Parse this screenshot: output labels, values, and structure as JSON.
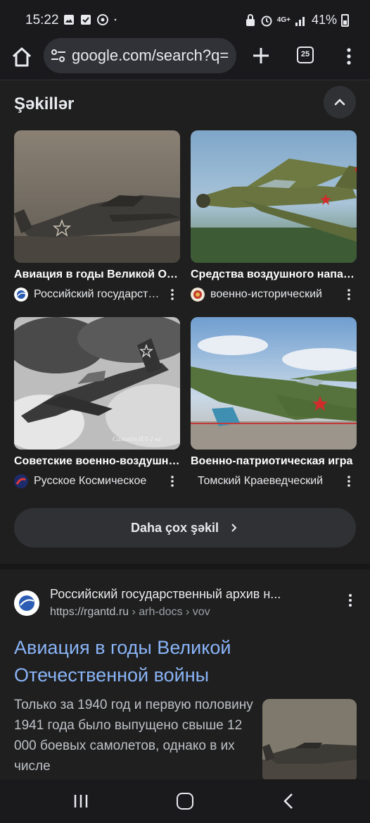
{
  "status_bar": {
    "time": "15:22",
    "network": "4G+",
    "battery": "41%"
  },
  "toolbar": {
    "url": "google.com/search?q=",
    "tab_count": "25"
  },
  "images_section": {
    "title": "Şəkillər",
    "more_button_label": "Daha çox şəkil",
    "cards": [
      {
        "caption": "Авиация в годы Великой Отечественной войны",
        "source": "Российский государственный архив"
      },
      {
        "caption": "Средства воздушного нападения",
        "source": "военно-исторический"
      },
      {
        "caption": "Советские военно-воздушные силы",
        "source": "Русское Космическое"
      },
      {
        "caption": "Военно-патриотическая игра",
        "source": "Томский Краеведческий"
      }
    ],
    "photo_text": "Самолёт ИЛ-2 на"
  },
  "result": {
    "site_name": "Российский государственный архив н...",
    "url_host": "https://rgantd.ru",
    "url_path": " › arh-docs › vov",
    "title": "Авиация в годы Великой Отечественной войны",
    "snippet": "Только за 1940 год и первую половину 1941 года было выпущено свыше 12 000 боевых самолетов, однако в их числе"
  },
  "icons": {
    "home": "home-icon",
    "tune": "tune-icon",
    "add": "add-icon",
    "menu": "more-vert-icon",
    "collapse": "chevron-up-icon",
    "chevron": "chevron-right-icon"
  }
}
